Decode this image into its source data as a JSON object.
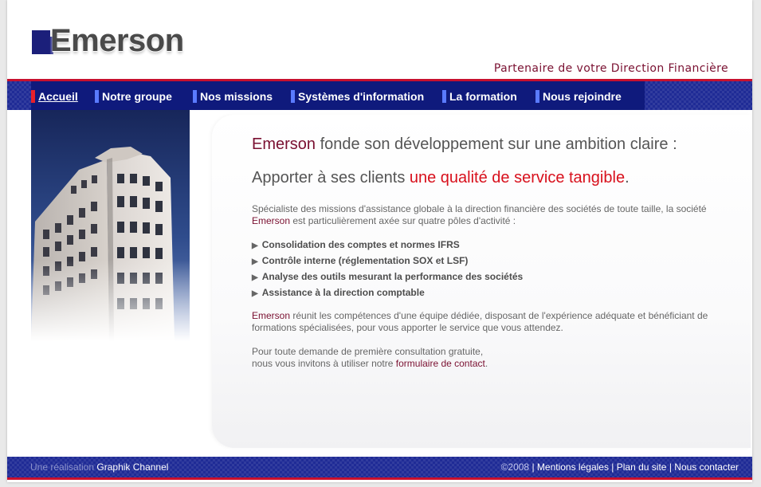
{
  "header": {
    "logo_text": "Emerson",
    "tagline": "Partenaire de votre Direction Financière"
  },
  "nav": {
    "items": [
      {
        "label": "Accueil",
        "active": true
      },
      {
        "label": "Notre groupe"
      },
      {
        "label": "Nos missions"
      },
      {
        "label": "Systèmes d'information"
      },
      {
        "label": "La formation"
      },
      {
        "label": "Nous rejoindre"
      }
    ]
  },
  "main": {
    "headline1_brand": "Emerson",
    "headline1_rest": " fonde son développement sur une ambition claire :",
    "headline2_start": "Apporter à ses clients ",
    "headline2_highlight": "une qualité de service tangible",
    "headline2_end": ".",
    "intro_text": "Spécialiste des missions d'assistance globale à la direction financière des sociétés de toute taille, la société ",
    "intro_brand": "Emerson",
    "intro_end": " est particulièrement axée sur quatre pôles d'activité :",
    "bullets": [
      "Consolidation des comptes et normes IFRS",
      "Contrôle interne (réglementation SOX et LSF)",
      "Analyse des outils mesurant la performance des sociétés",
      "Assistance à la direction comptable"
    ],
    "para2_brand": "Emerson",
    "para2_text": " réunit les compétences d'une équipe dédiée, disposant de l'expérience adéquate et bénéficiant de formations spécialisées, pour vous apporter le service que vous attendez.",
    "para3_line1": "Pour toute demande de première consultation gratuite,",
    "para3_line2": "nous vous invitons à utiliser notre ",
    "contact_link": "formulaire de contact",
    "para3_end": "."
  },
  "footer": {
    "credit_prefix": "Une réalisation ",
    "credit_name": "Graphik Channel",
    "copyright": "©2008",
    "links": [
      "Mentions légales",
      "Plan du site",
      "Nous contacter"
    ],
    "separator": " | "
  },
  "colors": {
    "brand": "#7a1031",
    "highlight": "#d8101c",
    "nav_blue": "#1f2b96",
    "accent_red": "#c8102e"
  }
}
